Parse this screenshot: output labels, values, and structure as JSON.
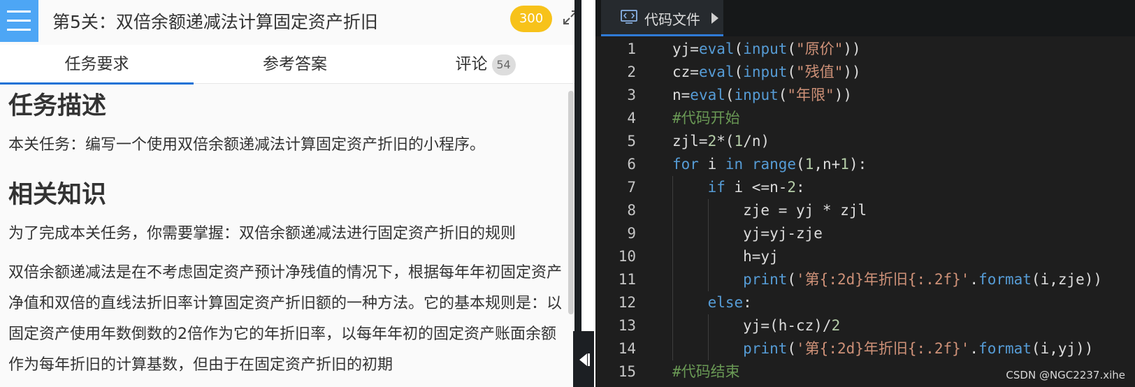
{
  "header": {
    "title": "第5关：双倍余额递减法计算固定资产折旧",
    "score": "300"
  },
  "tabs": [
    {
      "label": "任务要求"
    },
    {
      "label": "参考答案"
    },
    {
      "label": "评论",
      "count": "54"
    }
  ],
  "content": {
    "section1_heading": "任务描述",
    "section1_text": "本关任务：编写一个使用双倍余额递减法计算固定资产折旧的小程序。",
    "section2_heading": "相关知识",
    "section2_text1": "为了完成本关任务，你需要掌握：双倍余额递减法进行固定资产折旧的规则",
    "section2_text2": "双倍余额递减法是在不考虑固定资产预计净残值的情况下，根据每年年初固定资产净值和双倍的直线法折旧率计算固定资产折旧额的一种方法。它的基本规则是：以固定资产使用年数倒数的2倍作为它的年折旧率，以每年年初的固定资产账面余额作为每年折旧的计算基数，但由于在固定资产折旧的初期"
  },
  "editor": {
    "tab_label": "代码文件",
    "lines": [
      {
        "n": "1",
        "text": "yj=eval(input(\"原价\"))"
      },
      {
        "n": "2",
        "text": "cz=eval(input(\"残值\"))"
      },
      {
        "n": "3",
        "text": "n=eval(input(\"年限\"))"
      },
      {
        "n": "4",
        "text": "#代码开始"
      },
      {
        "n": "5",
        "text": "zjl=2*(1/n)"
      },
      {
        "n": "6",
        "text": "for i in range(1,n+1):"
      },
      {
        "n": "7",
        "text": "    if i <=n-2:"
      },
      {
        "n": "8",
        "text": "        zje = yj * zjl"
      },
      {
        "n": "9",
        "text": "        yj=yj-zje"
      },
      {
        "n": "10",
        "text": "        h=yj"
      },
      {
        "n": "11",
        "text": "        print('第{:2d}年折旧{:.2f}'.format(i,zje))"
      },
      {
        "n": "12",
        "text": "    else:"
      },
      {
        "n": "13",
        "text": "        yj=(h-cz)/2"
      },
      {
        "n": "14",
        "text": "        print('第{:2d}年折旧{:.2f}'.format(i,yj))"
      },
      {
        "n": "15",
        "text": "#代码结束"
      }
    ]
  },
  "watermark": "CSDN @NGC2237.xihe",
  "colors": {
    "accent_blue": "#4da6f5",
    "tab_underline": "#1a72d6",
    "score_badge": "#f7c21a",
    "editor_bg": "#1e1e1e"
  }
}
